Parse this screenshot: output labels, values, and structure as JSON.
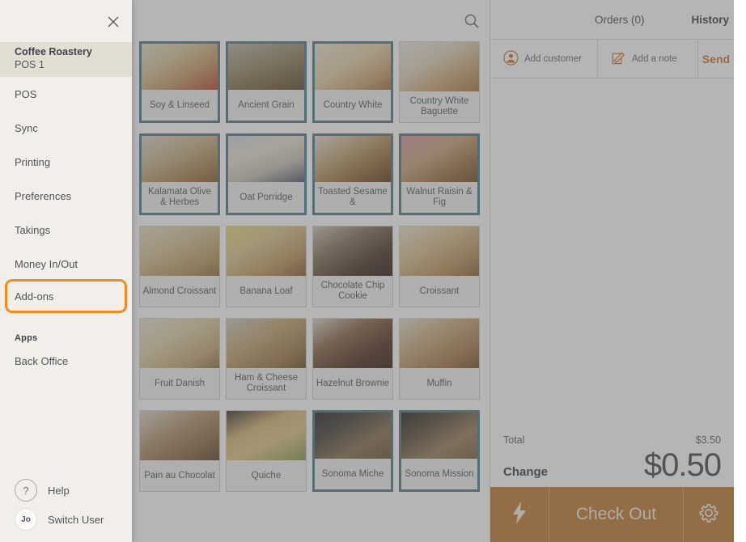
{
  "sidebar": {
    "close_icon": "close-icon",
    "account": {
      "name": "Coffee Roastery",
      "sub": "POS 1"
    },
    "items": [
      {
        "label": "POS"
      },
      {
        "label": "Sync"
      },
      {
        "label": "Printing"
      },
      {
        "label": "Preferences"
      },
      {
        "label": "Takings"
      },
      {
        "label": "Money In/Out"
      },
      {
        "label": "Add-ons",
        "highlighted": true
      }
    ],
    "group_label": "Apps",
    "apps": [
      {
        "label": "Back Office"
      }
    ],
    "bottom": [
      {
        "label": "Help",
        "icon": "question-mark-icon"
      },
      {
        "label": "Switch User",
        "icon": "user-avatar",
        "initials": "Jo"
      }
    ],
    "highlight_color": "#f28b20"
  },
  "topbar": {
    "search_icon": "search-icon"
  },
  "products": [
    {
      "name": "Soy & Linseed",
      "selected": true,
      "img": "ph-soy"
    },
    {
      "name": "Ancient Grain",
      "selected": true,
      "img": "ph-ancient"
    },
    {
      "name": "Country White",
      "selected": true,
      "img": "ph-cwhite"
    },
    {
      "name": "Country White Baguette",
      "selected": false,
      "img": "ph-cwbag"
    },
    {
      "name": "Kalamata Olive & Herbes",
      "selected": true,
      "img": "ph-kalamata"
    },
    {
      "name": "Oat Porridge",
      "selected": true,
      "img": "ph-oat"
    },
    {
      "name": "Toasted Sesame &",
      "selected": true,
      "img": "ph-toasted"
    },
    {
      "name": "Walnut Raisin & Fig",
      "selected": true,
      "img": "ph-walnut"
    },
    {
      "name": "Almond Croissant",
      "selected": false,
      "img": "ph-almond"
    },
    {
      "name": "Banana Loaf",
      "selected": false,
      "img": "ph-banana"
    },
    {
      "name": "Chocolate Chip Cookie",
      "selected": false,
      "img": "ph-choccook"
    },
    {
      "name": "Croissant",
      "selected": false,
      "img": "ph-croissant"
    },
    {
      "name": "Fruit Danish",
      "selected": false,
      "img": "ph-danish"
    },
    {
      "name": "Ham & Cheese Croissant",
      "selected": false,
      "img": "ph-ham"
    },
    {
      "name": "Hazelnut Brownie",
      "selected": false,
      "img": "ph-brownie"
    },
    {
      "name": "Muffin",
      "selected": false,
      "img": "ph-muffin"
    },
    {
      "name": "Pain au Chocolat",
      "selected": false,
      "img": "ph-pain"
    },
    {
      "name": "Quiche",
      "selected": false,
      "img": "ph-quiche"
    },
    {
      "name": "Sonoma Miche",
      "selected": true,
      "img": "ph-miche"
    },
    {
      "name": "Sonoma Mission",
      "selected": true,
      "img": "ph-mission"
    }
  ],
  "order_panel": {
    "orders_tab": "Orders (0)",
    "history_tab": "History",
    "add_customer": "Add customer",
    "add_note": "Add a note",
    "send": "Send",
    "total_label": "Total",
    "total_value": "$3.50",
    "change_label": "Change",
    "change_value": "$0.50",
    "checkout_label": "Check Out",
    "bolt_icon": "lightning-bolt-icon",
    "gear_icon": "gear-icon",
    "accent_color": "#c07d33",
    "link_color": "#d2762a"
  }
}
